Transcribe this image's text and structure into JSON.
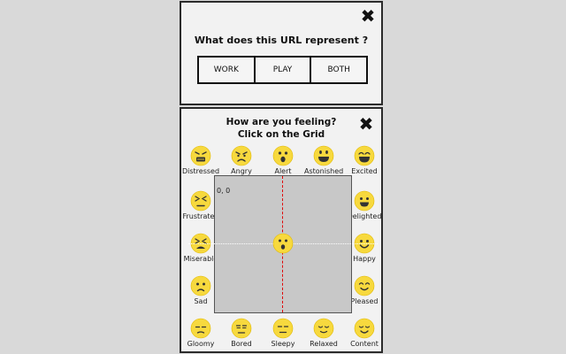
{
  "url_panel": {
    "question": "What does this URL represent ?",
    "choices": [
      "WORK",
      "PLAY",
      "BOTH"
    ]
  },
  "mood_panel": {
    "title_line1": "How are you feeling?",
    "title_line2": "Click on the Grid",
    "grid_origin_label": "0, 0",
    "emotions": {
      "top": [
        "Distressed",
        "Angry",
        "Alert",
        "Astonished",
        "Excited"
      ],
      "left": [
        "Frustrated",
        "Miserable",
        "Sad"
      ],
      "right": [
        "Delighted",
        "Happy",
        "Pleased"
      ],
      "bottom": [
        "Gloomy",
        "Bored",
        "Sleepy",
        "Relaxed",
        "Content"
      ]
    }
  },
  "colors": {
    "panel_bg": "#f2f2f2",
    "page_bg": "#d9d9d9",
    "face_yellow": "#f7d93e",
    "grid_bg": "#c8c8c8",
    "axis_vertical": "#e00000",
    "axis_horizontal": "#ffffff"
  }
}
